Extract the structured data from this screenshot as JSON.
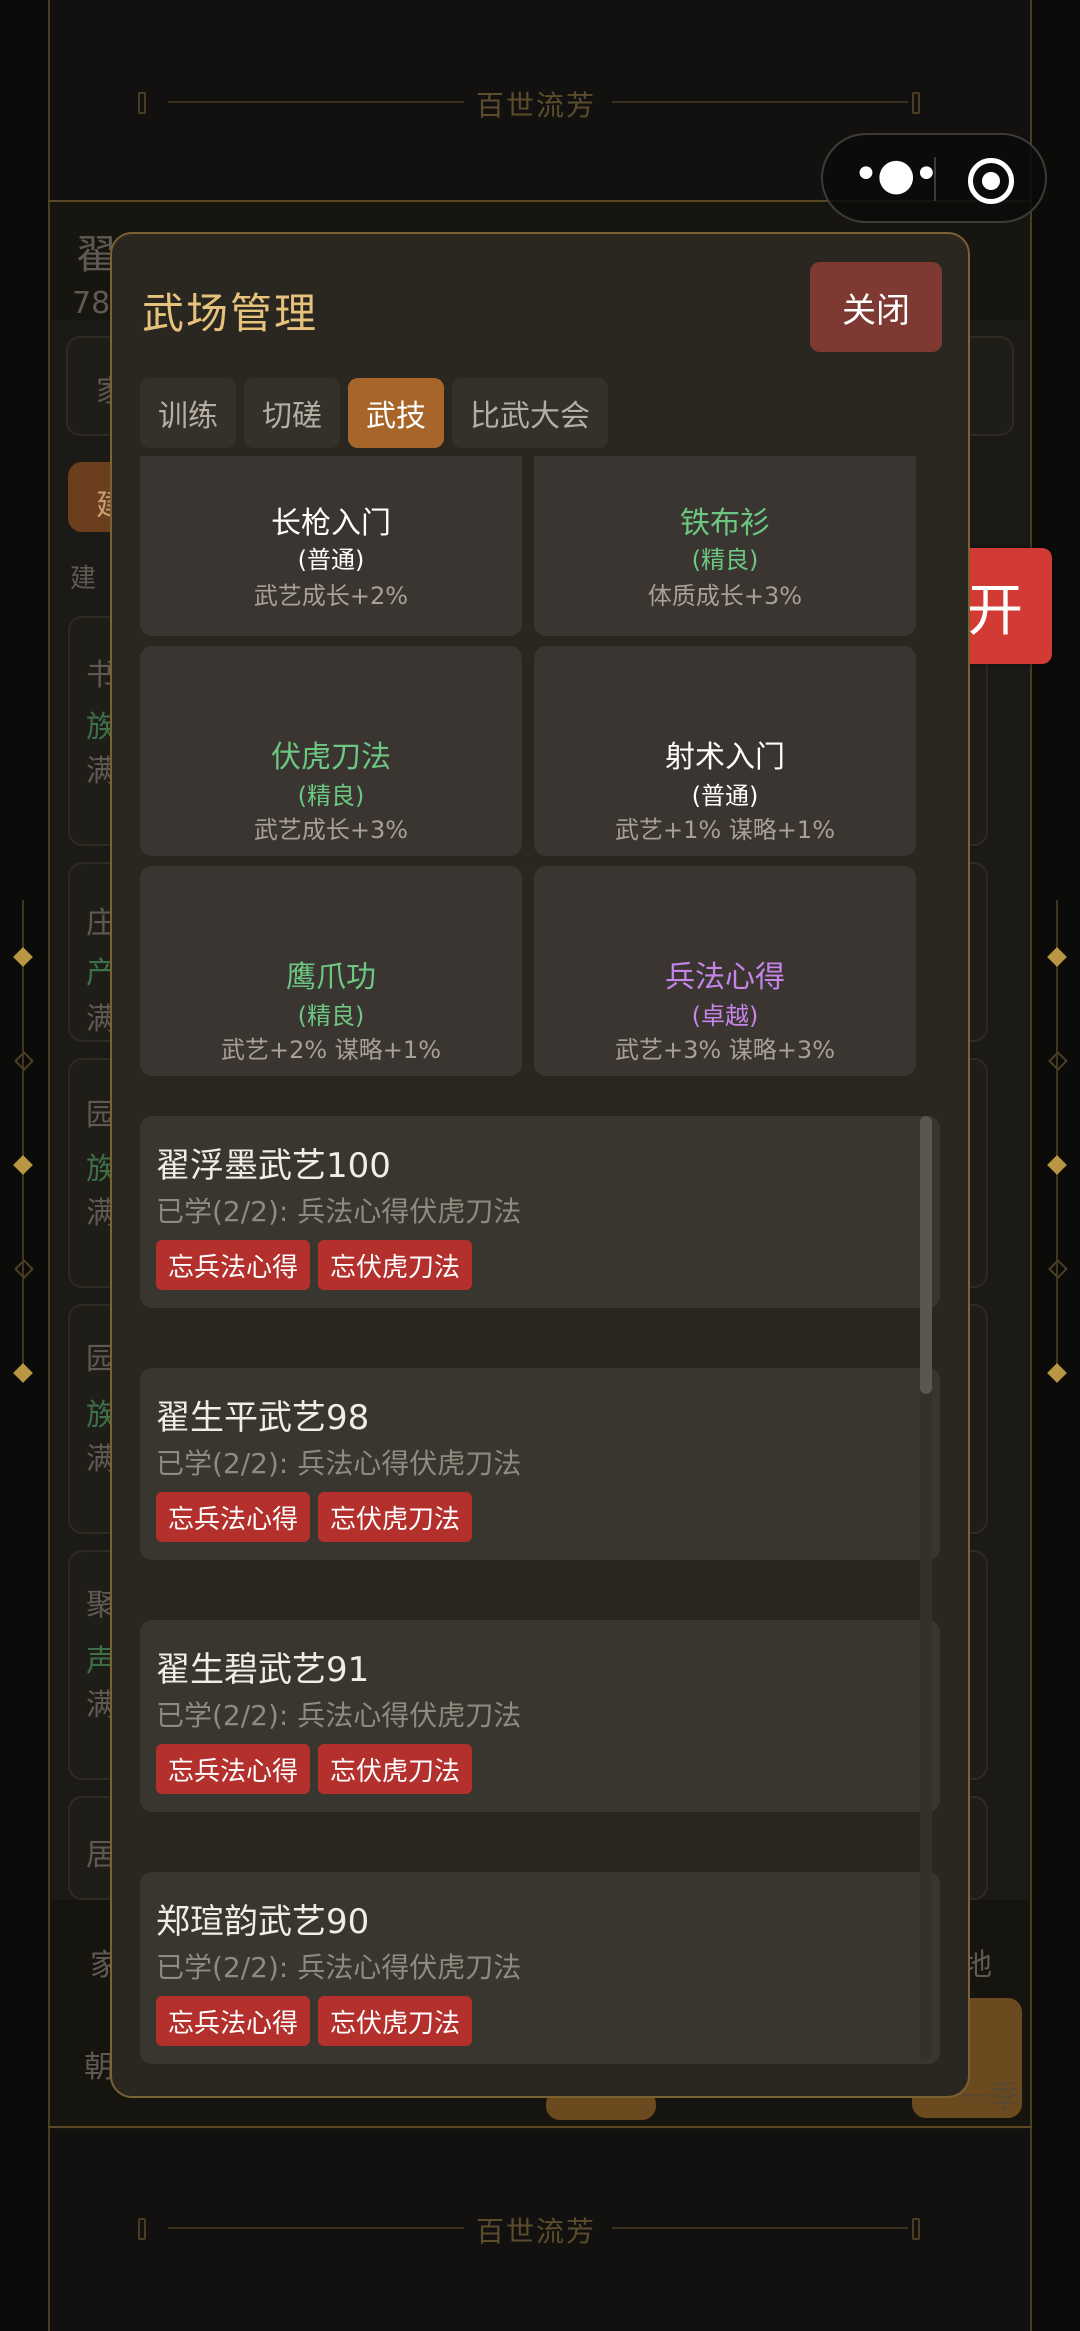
{
  "background": {
    "banner": "百世流芳",
    "partial_texts": {
      "left_header_name": "翟",
      "left_header_num": "78",
      "left_items": [
        "家",
        "建",
        "建",
        "书",
        "族",
        "满",
        "庄",
        "产",
        "满",
        "园",
        "族",
        "满",
        "园",
        "族",
        "满",
        "聚",
        "声",
        "满",
        "居"
      ],
      "bottom_left_1": "家",
      "bottom_left_2": "朝",
      "bottom_right_1": "地",
      "bottom_right_2": "一季"
    }
  },
  "capsule": {
    "more_icon": "more-dots-icon",
    "close_icon": "target-icon"
  },
  "open_button": {
    "label": "开"
  },
  "modal": {
    "title": "武场管理",
    "close_label": "关闭",
    "tabs": [
      {
        "label": "训练",
        "active": false
      },
      {
        "label": "切磋",
        "active": false
      },
      {
        "label": "武技",
        "active": true
      },
      {
        "label": "比武大会",
        "active": false
      }
    ],
    "skills": [
      {
        "name": "长枪入门",
        "grade": "(普通)",
        "effect": "武艺成长+2%",
        "quality": "common"
      },
      {
        "name": "铁布衫",
        "grade": "(精良)",
        "effect": "体质成长+3%",
        "quality": "fine"
      },
      {
        "name": "伏虎刀法",
        "grade": "(精良)",
        "effect": "武艺成长+3%",
        "quality": "fine"
      },
      {
        "name": "射术入门",
        "grade": "(普通)",
        "effect": "武艺+1% 谋略+1%",
        "quality": "common"
      },
      {
        "name": "鹰爪功",
        "grade": "(精良)",
        "effect": "武艺+2% 谋略+1%",
        "quality": "fine"
      },
      {
        "name": "兵法心得",
        "grade": "(卓越)",
        "effect": "武艺+3% 谋略+3%",
        "quality": "excellent"
      }
    ],
    "people": [
      {
        "name": "翟浮墨武艺100",
        "learned": "已学(2/2): 兵法心得伏虎刀法",
        "buttons": [
          "忘兵法心得",
          "忘伏虎刀法"
        ]
      },
      {
        "name": "翟生平武艺98",
        "learned": "已学(2/2): 兵法心得伏虎刀法",
        "buttons": [
          "忘兵法心得",
          "忘伏虎刀法"
        ]
      },
      {
        "name": "翟生碧武艺91",
        "learned": "已学(2/2): 兵法心得伏虎刀法",
        "buttons": [
          "忘兵法心得",
          "忘伏虎刀法"
        ]
      },
      {
        "name": "郑瑄韵武艺90",
        "learned": "已学(2/2): 兵法心得伏虎刀法",
        "buttons": [
          "忘兵法心得",
          "忘伏虎刀法"
        ]
      }
    ],
    "scroll_position": 0.0
  },
  "colors": {
    "accent_gold": "#e7c27d",
    "tab_active": "#a7652a",
    "forget_red": "#b3302c",
    "quality_common": "#ffffff",
    "quality_fine": "#6cc782",
    "quality_excellent": "#c484e8"
  }
}
